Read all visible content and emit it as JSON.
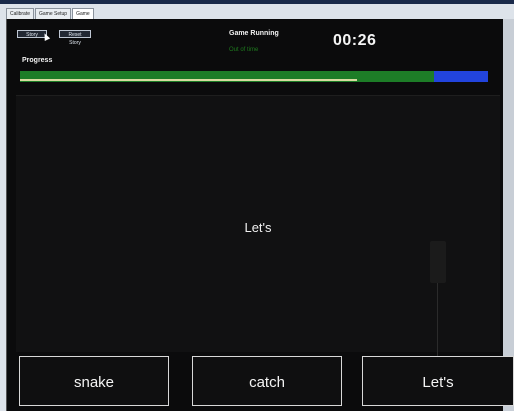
{
  "tabs": [
    {
      "label": "Calibrate",
      "active": false
    },
    {
      "label": "Game Setup",
      "active": false
    },
    {
      "label": "Game",
      "active": true
    }
  ],
  "controls": {
    "story_label": "Story",
    "reset_label": "Reset Story"
  },
  "status": {
    "title": "Game Running",
    "subtitle": "Out of time"
  },
  "timer": "00:26",
  "progress": {
    "label": "Progress",
    "fill_fraction": 0.885,
    "line_fraction": 0.72
  },
  "stage": {
    "word": "Let's"
  },
  "choices": [
    "snake",
    "catch",
    "Let's"
  ],
  "colors": {
    "background": "#0b0b0c",
    "progress_fill": "#1d7d27",
    "progress_track": "#2244dd",
    "progress_line": "#d7dca0",
    "status_subtitle": "#1e7a1e"
  },
  "icons": {
    "cursor": "mouse-pointer-icon"
  }
}
